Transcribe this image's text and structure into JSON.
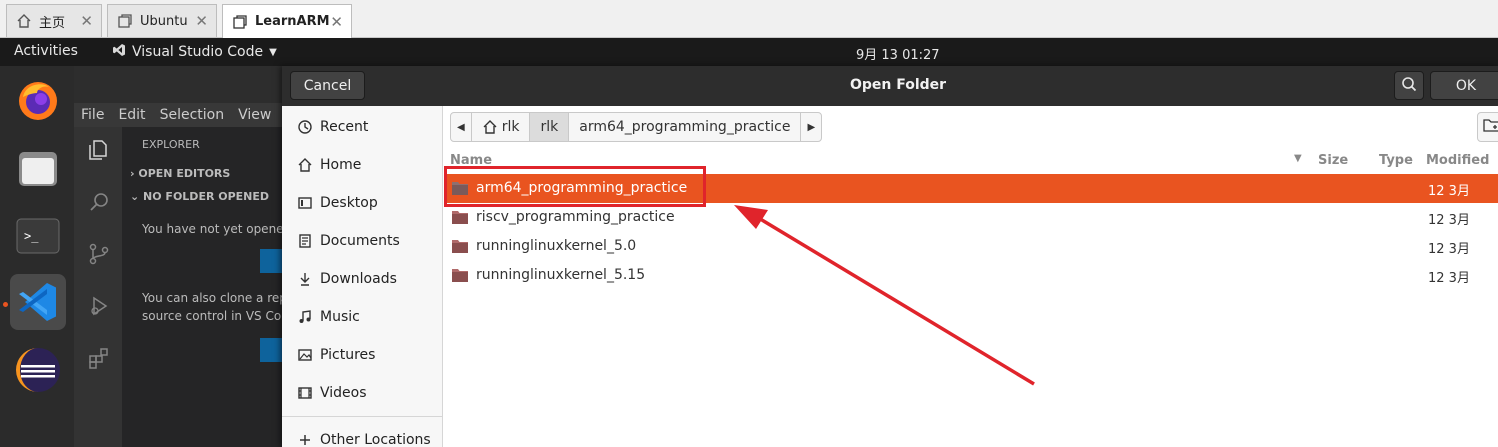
{
  "browser_tabs": [
    {
      "label": "主页",
      "icon": "home-icon"
    },
    {
      "label": "Ubuntu",
      "icon": "window-icon"
    },
    {
      "label": "LearnARM",
      "icon": "window-icon",
      "active": true
    }
  ],
  "topbar": {
    "activities": "Activities",
    "app_name": "Visual Studio Code",
    "clock": "9月 13  01:27"
  },
  "dock": [
    "firefox-icon",
    "files-icon",
    "terminal-icon",
    "vscode-icon",
    "eclipse-icon"
  ],
  "vscode": {
    "menu": [
      "File",
      "Edit",
      "Selection",
      "View",
      "G"
    ],
    "explorer_title": "EXPLORER",
    "open_editors": "OPEN EDITORS",
    "no_folder": "NO FOLDER OPENED",
    "msg1": "You have not yet opene",
    "msg2": "You can also clone a rep",
    "msg3": "source control in VS Coc"
  },
  "dialog": {
    "title": "Open Folder",
    "cancel": "Cancel",
    "ok": "OK",
    "places": [
      {
        "label": "Recent",
        "icon": "clock-icon"
      },
      {
        "label": "Home",
        "icon": "home-icon"
      },
      {
        "label": "Desktop",
        "icon": "desktop-icon"
      },
      {
        "label": "Documents",
        "icon": "document-icon"
      },
      {
        "label": "Downloads",
        "icon": "download-icon"
      },
      {
        "label": "Music",
        "icon": "music-icon"
      },
      {
        "label": "Pictures",
        "icon": "picture-icon"
      },
      {
        "label": "Videos",
        "icon": "video-icon"
      },
      {
        "label": "Other Locations",
        "icon": "plus-icon"
      }
    ],
    "path": [
      "rlk",
      "rlk",
      "arm64_programming_practice"
    ],
    "columns": {
      "name": "Name",
      "size": "Size",
      "type": "Type",
      "modified": "Modified"
    },
    "files": [
      {
        "name": "arm64_programming_practice",
        "modified": "12 3月",
        "selected": true
      },
      {
        "name": "riscv_programming_practice",
        "modified": "12 3月"
      },
      {
        "name": "runninglinuxkernel_5.0",
        "modified": "12 3月"
      },
      {
        "name": "runninglinuxkernel_5.15",
        "modified": "12 3月"
      }
    ]
  },
  "colors": {
    "accent": "#e95420",
    "annotation": "#e0242b",
    "dialog_header": "#2d2d2d"
  }
}
